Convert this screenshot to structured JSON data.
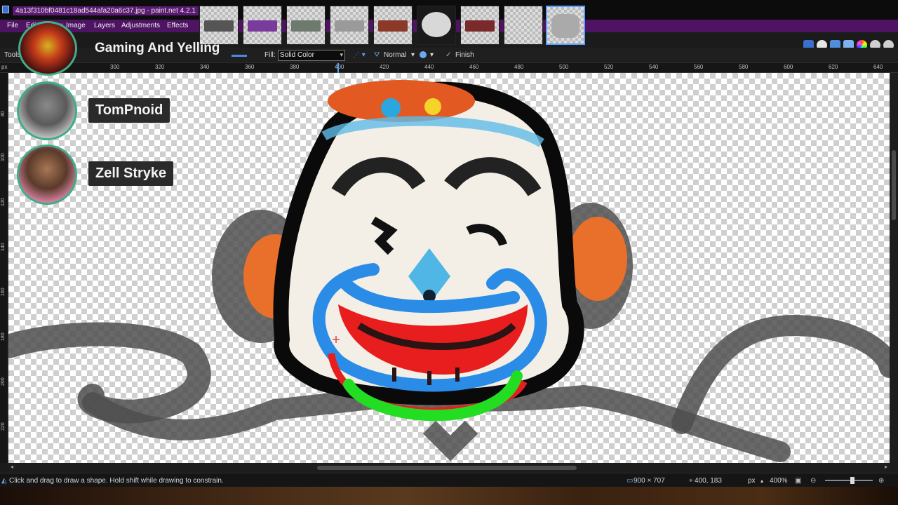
{
  "window": {
    "title": "4a13f310bf0481c18ad544afa20a6c37.jpg - paint.net 4.2.1"
  },
  "menu": {
    "items": [
      "File",
      "Edit",
      "View",
      "Image",
      "Layers",
      "Adjustments",
      "Effects"
    ]
  },
  "toolbar": {
    "tools_label": "Tools",
    "fill_label": "Fill:",
    "fill_value": "Solid Color",
    "blend_mode": "Normal",
    "finish_label": "Finish"
  },
  "ruler": {
    "unit": "px",
    "ticks": [
      "300",
      "320",
      "340",
      "360",
      "380",
      "400",
      "420",
      "440",
      "460",
      "480",
      "500",
      "520",
      "540",
      "560",
      "580",
      "600",
      "620",
      "640"
    ],
    "vticks": [
      "80",
      "100",
      "120",
      "140",
      "160",
      "180",
      "200",
      "220"
    ]
  },
  "status": {
    "hint": "Click and drag to draw a shape. Hold shift while drawing to constrain.",
    "image_size": "900 × 707",
    "cursor_pos": "400, 183",
    "unit": "px",
    "zoom": "400%"
  },
  "overlay": {
    "title": "Gaming And Yelling",
    "participants": [
      "TomPnoid",
      "Zell Stryke"
    ]
  },
  "colors": {
    "accent_purple": "#4e1463",
    "overlay_ring": "#3fae88"
  },
  "icons": {
    "app": "paintnet-icon",
    "finish": "check-icon",
    "zoom_out": "zoom-out-icon",
    "zoom_in": "zoom-in-icon"
  }
}
